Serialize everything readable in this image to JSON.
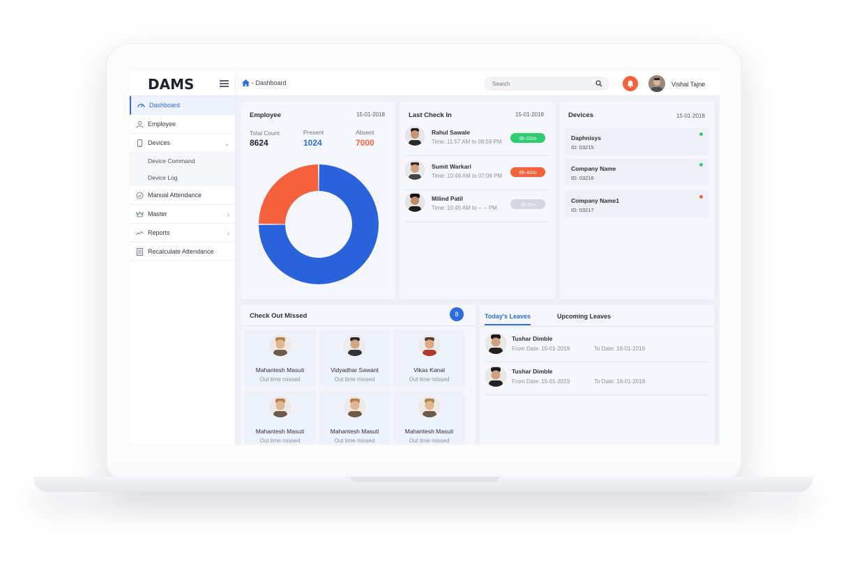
{
  "app": {
    "logo": "DAMS"
  },
  "header": {
    "breadcrumb": "- Dashboard",
    "search_placeholder": "Search",
    "user_name": "Vishal Tajne",
    "notification_color": "#f5623d"
  },
  "sidebar": {
    "items": [
      {
        "label": "Dashboard",
        "icon": "dashboard-icon",
        "active": true
      },
      {
        "label": "Employee",
        "icon": "user-icon"
      },
      {
        "label": "Devices",
        "icon": "mobile-device-icon",
        "expanded": true
      },
      {
        "label": "Device Command",
        "sub": true
      },
      {
        "label": "Device Log",
        "sub": true
      },
      {
        "label": "Manual Attendance",
        "icon": "check-circle-icon"
      },
      {
        "label": "Master",
        "icon": "crown-icon"
      },
      {
        "label": "Reports",
        "icon": "trend-icon"
      },
      {
        "label": "Recalculate Attendance",
        "icon": "calculator-icon"
      }
    ]
  },
  "employee_card": {
    "title": "Employee",
    "date": "15-01-2018",
    "total_label": "Total Count",
    "total_value": "8624",
    "present_label": "Present",
    "present_value": "1024",
    "absent_label": "Absent",
    "absent_value": "7000",
    "present_color": "#2c6be0",
    "absent_color": "#f5623d"
  },
  "chart_data": {
    "type": "pie",
    "categories": [
      "Present",
      "Absent"
    ],
    "values": [
      75,
      25
    ],
    "colors": [
      "#2a62d9",
      "#f5613d"
    ],
    "donut": true
  },
  "last_checkin": {
    "title": "Last Check In",
    "date": "15-01-2018",
    "rows": [
      {
        "name": "Rahul Sawale",
        "time": "Time: 11:57 AM to 08:59 PM",
        "duration": "9h 02m",
        "color": "#2ecc71"
      },
      {
        "name": "Sumit Warkari",
        "time": "Time: 10:49 AM to 07:09 PM",
        "duration": "8h 40m",
        "color": "#f5623d"
      },
      {
        "name": "Milind Patil",
        "time": "Time: 10:45 AM to -- -- PM",
        "duration": "0h 0m",
        "color": "#d3d6dd"
      }
    ]
  },
  "devices": {
    "title": "Devices",
    "date": "15-01-2018",
    "items": [
      {
        "name": "Daphnisys",
        "id": "ID: 03215",
        "status_color": "#2ecc71"
      },
      {
        "name": "Company Name",
        "id": "ID: 03216",
        "status_color": "#2ecc71"
      },
      {
        "name": "Company Name1",
        "id": "ID: 03217",
        "status_color": "#f5623d"
      }
    ]
  },
  "checkout_missed": {
    "title": "Check Out Missed",
    "count": "8",
    "items": [
      {
        "name": "Mahantesh Masuti",
        "status": "Out time missed"
      },
      {
        "name": "Vidyadhar Sawant",
        "status": "Out time missed"
      },
      {
        "name": "Vikas Kanal",
        "status": "Out time missed"
      },
      {
        "name": "Mahantesh Masuti",
        "status": "Out time missed"
      },
      {
        "name": "Mahantesh Masuti",
        "status": "Out time missed"
      },
      {
        "name": "Mahantesh Masuti",
        "status": "Out time missed"
      }
    ]
  },
  "leaves": {
    "tabs": [
      "Today's Leaves",
      "Upcoming Leaves"
    ],
    "rows": [
      {
        "name": "Tushar Dimble",
        "from": "From Date: 15-01-2019",
        "to": "To Date: 18-01-2019"
      },
      {
        "name": "Tushar Dimble",
        "from": "From Date: 15-01-2019",
        "to": "To Date: 18-01-2019"
      }
    ]
  }
}
